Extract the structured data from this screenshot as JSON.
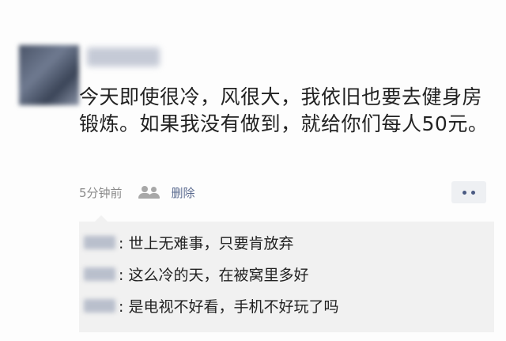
{
  "post": {
    "text": "今天即使很冷，风很大，我依旧也要去健身房锻炼。如果我没有做到，就给你们每人50元。",
    "time": "5分钟前",
    "delete_label": "删除"
  },
  "comments": [
    {
      "text": ": 世上无难事，只要肯放弃"
    },
    {
      "text": ": 这么冷的天，在被窝里多好"
    },
    {
      "text": ": 是电视不好看，手机不好玩了吗"
    }
  ]
}
